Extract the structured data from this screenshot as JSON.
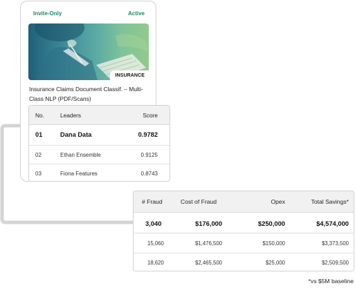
{
  "card": {
    "access_label": "Invite-Only",
    "status_label": "Active",
    "image_alt": "person reviewing insurance documents",
    "category_badge": "INSURANCE",
    "title": "Insurance Claims Document Classif. – Multi-Class NLP (PDF/Scans)",
    "accent_color": "#1f8a62"
  },
  "leaderboard": {
    "headers": {
      "no": "No.",
      "leader": "Leaders",
      "score": "Score"
    },
    "rows": [
      {
        "no": "01",
        "leader": "Dana Data",
        "score": "0.9782"
      },
      {
        "no": "02",
        "leader": "Ethan Ensemble",
        "score": "0.9125"
      },
      {
        "no": "03",
        "leader": "Fiona Features",
        "score": "0.8743"
      }
    ]
  },
  "fraud_table": {
    "headers": {
      "fraud_count": "# Fraud",
      "cost": "Cost of Fraud",
      "opex": "Opex",
      "savings": "Total Savings*"
    },
    "rows": [
      {
        "fraud_count": "3,040",
        "cost": "$176,000",
        "opex": "$250,000",
        "savings": "$4,574,000"
      },
      {
        "fraud_count": "15,060",
        "cost": "$1,476,500",
        "opex": "$150,000",
        "savings": "$3,373,500"
      },
      {
        "fraud_count": "18,620",
        "cost": "$2,465,500",
        "opex": "$25,000",
        "savings": "$2,509,500"
      }
    ]
  },
  "footnote": "*vs $5M baseline"
}
